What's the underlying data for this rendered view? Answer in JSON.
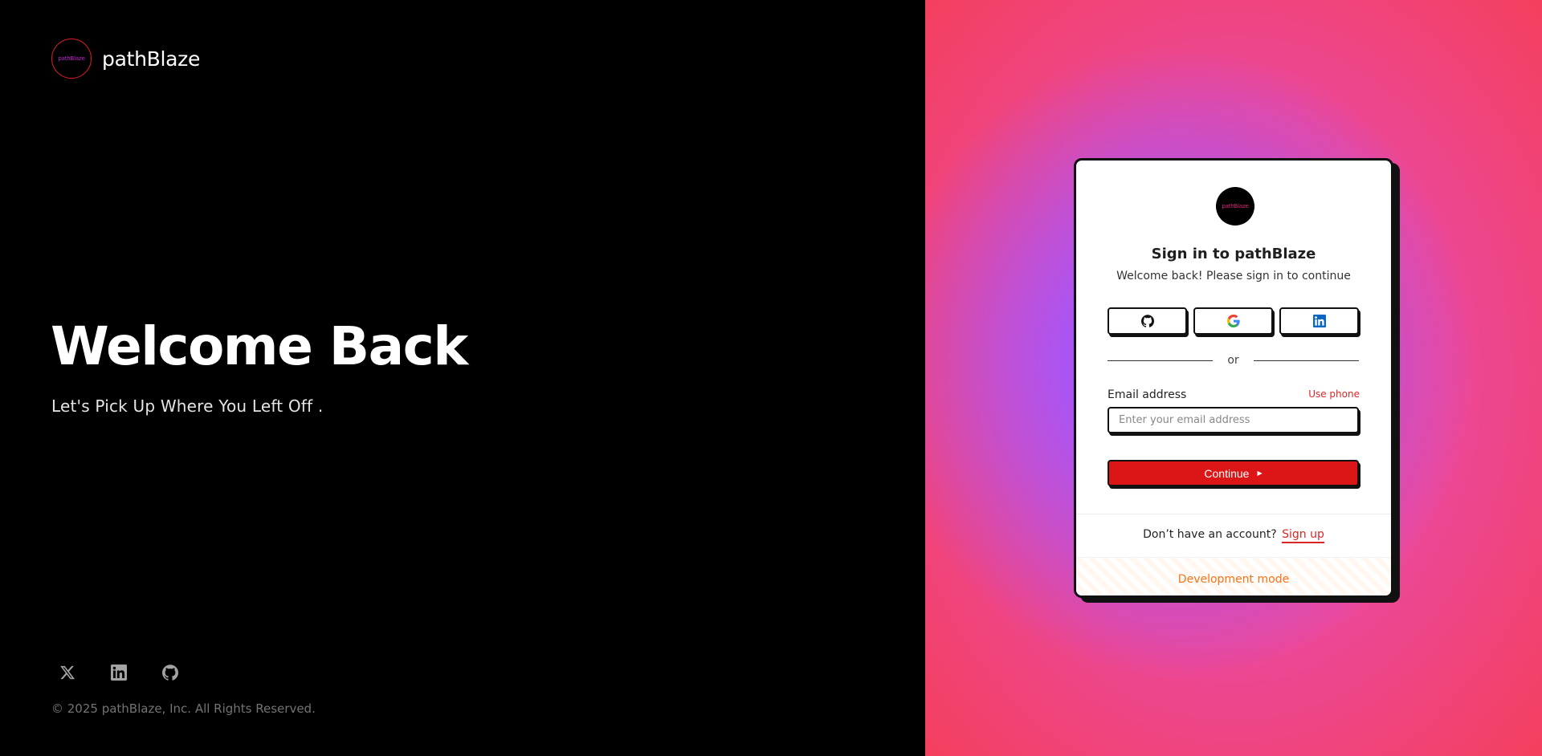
{
  "brand": {
    "logo_text": "pathBlaze",
    "name": "pathBlaze"
  },
  "hero": {
    "title": "Welcome Back",
    "subtitle": "Let's Pick Up Where You Left Off ."
  },
  "socials": [
    {
      "icon": "x-icon"
    },
    {
      "icon": "linkedin-icon"
    },
    {
      "icon": "github-icon"
    }
  ],
  "copyright": "© 2025 pathBlaze, Inc. All Rights Reserved.",
  "card": {
    "logo_text": "pathBlaze",
    "title": "Sign in to pathBlaze",
    "subtitle": "Welcome back! Please sign in to continue",
    "oauth": [
      {
        "provider": "github",
        "icon": "github-icon"
      },
      {
        "provider": "google",
        "icon": "google-icon"
      },
      {
        "provider": "linkedin",
        "icon": "linkedin-icon"
      }
    ],
    "divider_text": "or",
    "email_label": "Email address",
    "use_phone": "Use phone",
    "email_placeholder": "Enter your email address",
    "email_value": "",
    "continue_label": "Continue",
    "signup_prompt": "Don’t have an account?",
    "signup_link": "Sign up",
    "dev_mode": "Development mode"
  },
  "colors": {
    "accent_red": "#dc1616",
    "link_red": "#dc2626",
    "dev_orange": "#f97316",
    "gradient_pink": "#ec4899",
    "gradient_violet": "#8b5cf6"
  }
}
